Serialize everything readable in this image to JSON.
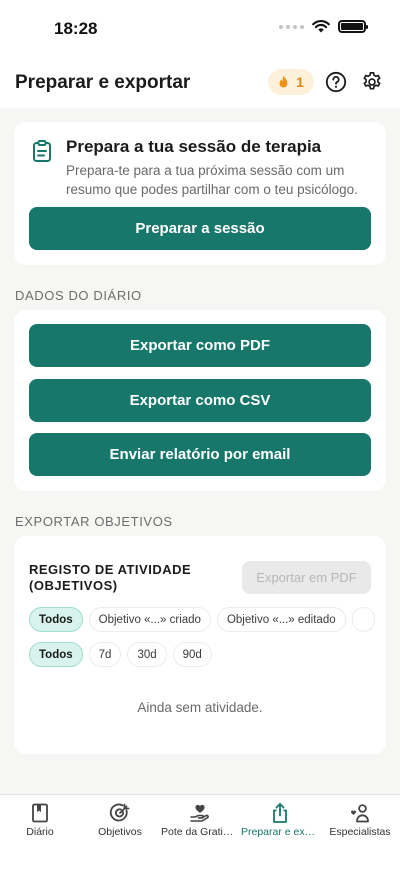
{
  "status_bar": {
    "time": "18:28"
  },
  "header": {
    "title": "Preparar e exportar",
    "streak_count": "1",
    "icons": [
      "fire-icon",
      "help-icon",
      "gear-icon"
    ]
  },
  "prep_card": {
    "title": "Prepara a tua sessão de terapia",
    "description": "Prepara-te para a tua próxima sessão com um resumo que podes partilhar com o teu psicólogo.",
    "button": "Preparar a sessão",
    "icon": "clipboard-icon"
  },
  "diary_section": {
    "label": "DADOS DO DIÁRIO",
    "buttons": [
      "Exportar como PDF",
      "Exportar como CSV",
      "Enviar relatório por email"
    ]
  },
  "goals_section": {
    "label": "EXPORTAR OBJETIVOS",
    "activity_title": "REGISTO DE ATIVIDADE (OBJETIVOS)",
    "export_button": "Exportar em PDF",
    "type_filters": [
      "Todos",
      "Objetivo «...» criado",
      "Objetivo «...» editado"
    ],
    "period_filters": [
      "Todos",
      "7d",
      "30d",
      "90d"
    ],
    "empty_text": "Ainda sem atividade."
  },
  "tab_bar": {
    "tabs": [
      {
        "label": "Diário",
        "icon": "book-icon"
      },
      {
        "label": "Objetivos",
        "icon": "target-icon"
      },
      {
        "label": "Pote da Gratidão",
        "icon": "hand-heart-icon"
      },
      {
        "label": "Preparar e exportar",
        "icon": "share-icon"
      },
      {
        "label": "Especialistas",
        "icon": "person-heart-icon"
      }
    ],
    "active_index": 3
  },
  "colors": {
    "accent": "#17776b",
    "chip_active_bg": "#d7f3ec",
    "streak_bg": "#fdf1dc",
    "streak_text": "#d9861a",
    "background": "#f6f6f4"
  }
}
